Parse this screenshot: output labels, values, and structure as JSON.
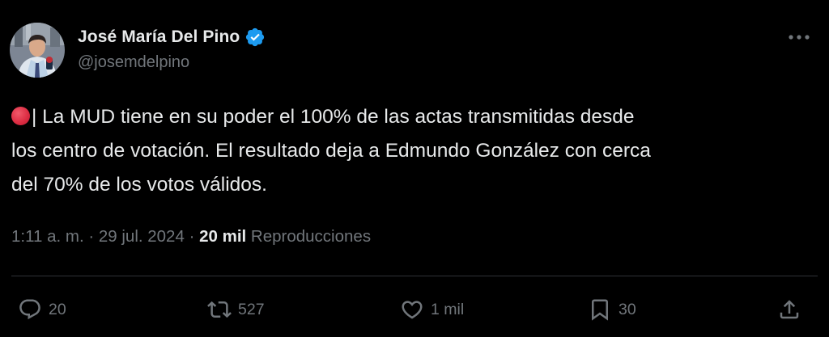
{
  "author": {
    "name": "José María Del Pino",
    "handle": "@josemdelpino",
    "verified": true
  },
  "tweet": {
    "emoji": "red-circle",
    "lines": [
      "| La MUD tiene en su poder el 100% de las actas transmitidas desde",
      "los centro de votación. El resultado deja a Edmundo González con cerca",
      "del 70% de los votos válidos."
    ]
  },
  "meta": {
    "time": "1:11 a. m.",
    "separator": " · ",
    "date": "29 jul. 2024",
    "views_count": "20 mil",
    "views_label": "Reproducciones"
  },
  "actions": {
    "replies": "20",
    "reposts": "527",
    "likes": "1 mil",
    "bookmarks": "30"
  },
  "colors": {
    "background": "#000000",
    "text": "#e7e9ea",
    "muted": "#71767b",
    "verified": "#1d9bf0",
    "divider": "#2f3336"
  },
  "icons": {
    "verified": "verified-badge-icon",
    "more": "more-options-icon",
    "reply": "reply-icon",
    "repost": "repost-icon",
    "like": "heart-icon",
    "bookmark": "bookmark-icon",
    "share": "share-icon"
  }
}
